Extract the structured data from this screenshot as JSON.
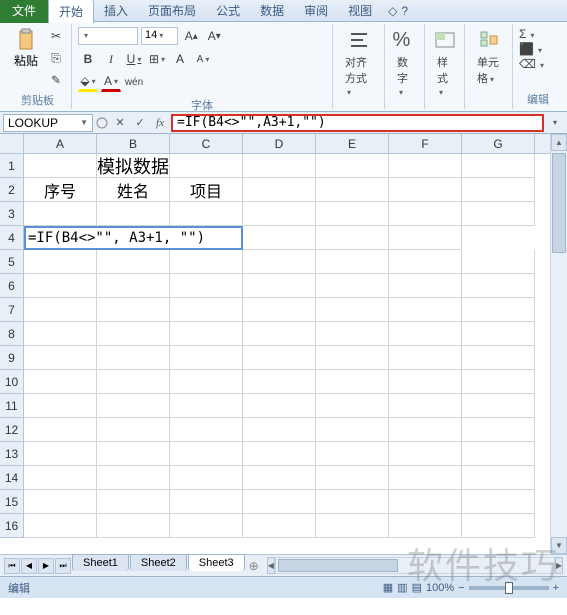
{
  "tabs": {
    "file": "文件",
    "items": [
      "开始",
      "插入",
      "页面布局",
      "公式",
      "数据",
      "审阅",
      "视图"
    ],
    "active": 0
  },
  "ribbon": {
    "clipboard": {
      "paste": "粘贴",
      "label": "剪贴板"
    },
    "font": {
      "size": "14",
      "label": "字体",
      "bold": "B",
      "italic": "I",
      "underline": "U",
      "a_large": "A",
      "a_small": "A"
    },
    "align": {
      "label": "对齐方式"
    },
    "number": {
      "icon": "%",
      "label": "数字"
    },
    "styles": {
      "label": "样式"
    },
    "cells": {
      "label": "单元格"
    },
    "editing": {
      "sigma": "Σ",
      "label": "编辑"
    }
  },
  "formula_bar": {
    "name_box": "LOOKUP",
    "formula": "=IF(B4<>\"\",A3+1,\"\")"
  },
  "grid": {
    "cols": [
      "A",
      "B",
      "C",
      "D",
      "E",
      "F",
      "G"
    ],
    "rows": [
      1,
      2,
      3,
      4,
      5,
      6,
      7,
      8,
      9,
      10,
      11,
      12,
      13,
      14,
      15,
      16
    ],
    "title": "模拟数据",
    "headers": [
      "序号",
      "姓名",
      "项目"
    ],
    "editing_cell": "=IF(B4<>\"\", A3+1, \"\")"
  },
  "sheets": {
    "list": [
      "Sheet1",
      "Sheet2",
      "Sheet3"
    ],
    "active": 2
  },
  "status": {
    "mode": "编辑",
    "zoom": "100%"
  },
  "watermark": "软件技巧"
}
